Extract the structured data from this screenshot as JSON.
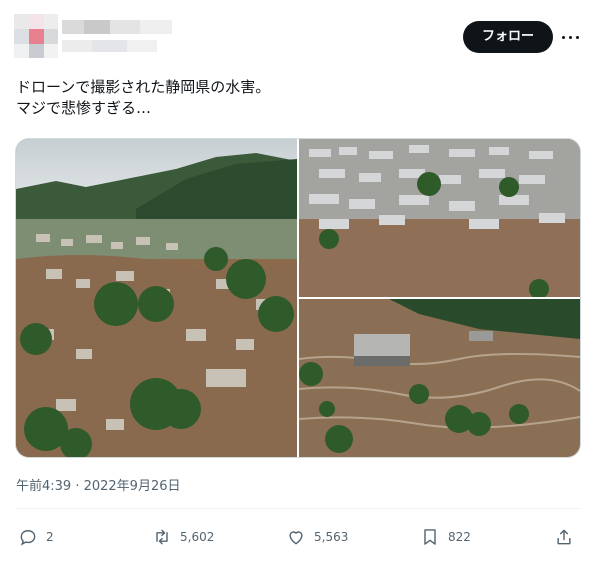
{
  "header": {
    "follow_label": "フォロー"
  },
  "tweet": {
    "text_lines": [
      "ドローンで撮影された静岡県の水害。",
      "マジで悲惨すぎる…"
    ],
    "timestamp": "午前4:39 · 2022年9月26日"
  },
  "media": {
    "images": [
      {
        "subject": "flooded-town-aerial-mountains"
      },
      {
        "subject": "flooded-residential-grid"
      },
      {
        "subject": "flood-water-rooftops-trees"
      }
    ]
  },
  "actions": {
    "replies": "2",
    "retweets": "5,602",
    "likes": "5,563",
    "bookmarks": "822"
  },
  "colors": {
    "text_primary": "#0f1419",
    "text_secondary": "#536471",
    "follow_bg": "#0f1419",
    "border": "#cfd9de",
    "flood_water": "#8a6a4f",
    "foliage": "#2f5a2a"
  }
}
